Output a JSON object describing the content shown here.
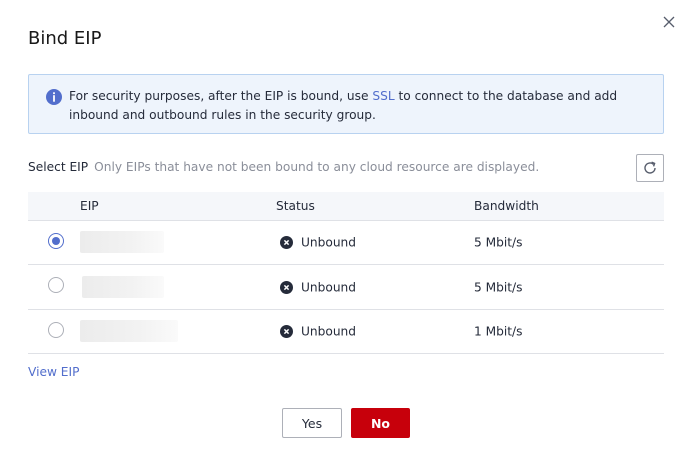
{
  "dialog": {
    "title": "Bind EIP"
  },
  "notice": {
    "text_before": "For security purposes, after the EIP is bound, use ",
    "link": "SSL",
    "text_after": " to connect to the database and add inbound and outbound rules in the security group."
  },
  "select": {
    "label": "Select EIP",
    "hint": "Only EIPs that have not been bound to any cloud resource are displayed."
  },
  "table": {
    "columns": [
      "EIP",
      "Status",
      "Bandwidth"
    ],
    "rows": [
      {
        "selected": true,
        "eip": "",
        "status": "Unbound",
        "bandwidth": "5 Mbit/s"
      },
      {
        "selected": false,
        "eip": "",
        "status": "Unbound",
        "bandwidth": "5 Mbit/s"
      },
      {
        "selected": false,
        "eip": "",
        "status": "Unbound",
        "bandwidth": "1 Mbit/s"
      }
    ]
  },
  "links": {
    "view_eip": "View EIP"
  },
  "buttons": {
    "yes": "Yes",
    "no": "No"
  },
  "colors": {
    "accent": "#526ecc",
    "primary_button": "#c7000b",
    "notice_bg": "#eef4fc",
    "notice_border": "#b8d2f0"
  },
  "icons": {
    "close": "close-icon",
    "info": "info-icon",
    "refresh": "refresh-icon",
    "status": "unbound-status-icon"
  }
}
